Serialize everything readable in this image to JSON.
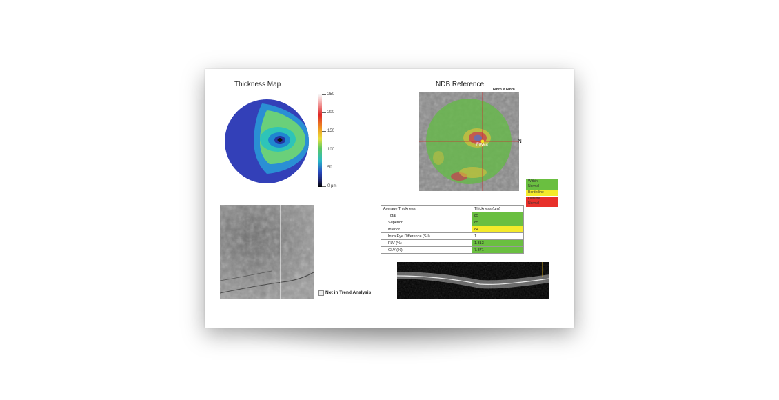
{
  "thickness_map": {
    "title": "Thickness Map",
    "colorbar_labels": [
      "250",
      "200",
      "150",
      "100",
      "50",
      "0 μm"
    ],
    "colorbar_values": [
      250,
      200,
      150,
      100,
      50,
      0
    ]
  },
  "ndb": {
    "title": "NDB Reference",
    "scan_size": "6mm x 6mm",
    "label_left": "T",
    "label_right": "N",
    "fovea_label": "Fovea"
  },
  "legend": [
    {
      "line1": "Within",
      "line2": "Normal",
      "color": "#6abf40"
    },
    {
      "line1": "Borderline",
      "line2": "",
      "color": "#f4ea2a"
    },
    {
      "line1": "Outside",
      "line2": "Normal",
      "color": "#e8302a"
    }
  ],
  "table": {
    "header_label": "Average Thickness",
    "header_value": "Thickness (μm)",
    "rows": [
      {
        "label": "Total",
        "value": "85",
        "status": "normal"
      },
      {
        "label": "Superior",
        "value": "85",
        "status": "normal"
      },
      {
        "label": "Inferior",
        "value": "84",
        "status": "borderline"
      },
      {
        "label": "Intra Eye Difference (S-I)",
        "value": "1",
        "status": "none"
      },
      {
        "label": "FLV (%)",
        "value": "1.313",
        "status": "normal"
      },
      {
        "label": "GLV (%)",
        "value": "7.871",
        "status": "normal"
      }
    ]
  },
  "trend": {
    "checkbox_label": "Not in Trend Analysis",
    "checked": false
  },
  "colors": {
    "normal": "#6abf40",
    "borderline": "#f4ea2a",
    "outside": "#e8302a"
  }
}
